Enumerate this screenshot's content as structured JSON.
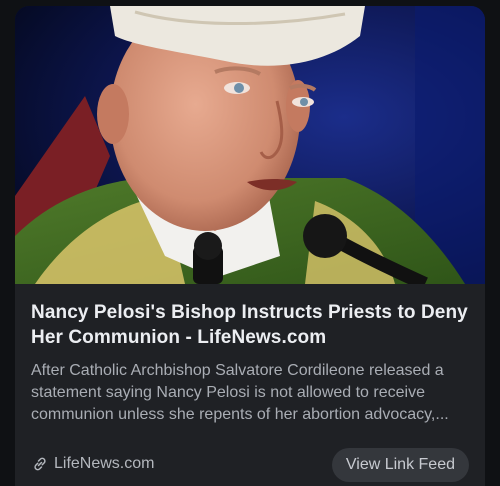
{
  "card": {
    "title": "Nancy Pelosi's Bishop Instructs Priests to Deny Her Communion - LifeNews.com",
    "description": "After Catholic Archbishop Salvatore Cordileone released a statement saying Nancy Pelosi is not allowed to receive communion unless she repents of her abortion advocacy,...",
    "source_domain": "LifeNews.com",
    "source_icon": "link-icon",
    "action_label": "View Link Feed"
  },
  "colors": {
    "background": "#0f1114",
    "card": "#1f2125",
    "title_text": "#eceef2",
    "body_text": "#a9adb4",
    "button_bg": "#34373c"
  }
}
